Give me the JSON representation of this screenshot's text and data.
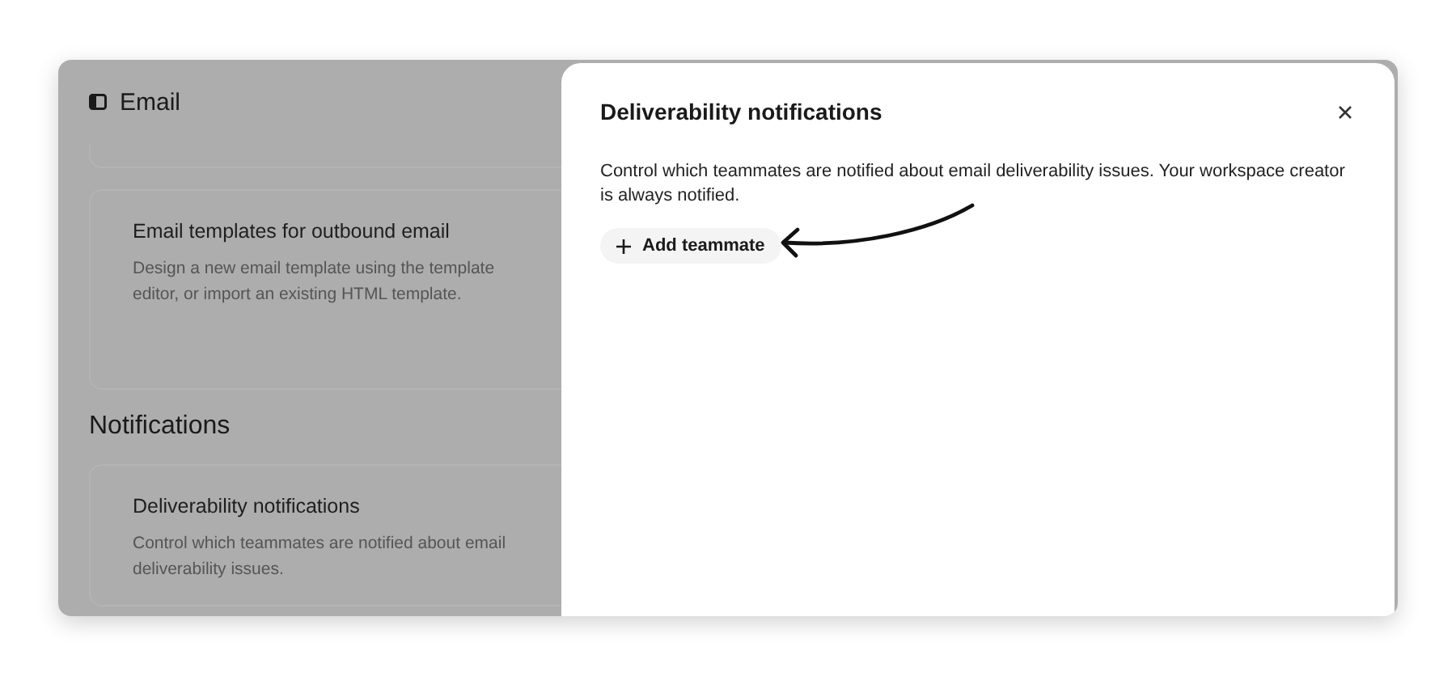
{
  "page": {
    "title": "Email",
    "email_cards": [
      {
        "title": "Email templates for outbound email",
        "description": "Design a new email template using the template editor, or import an existing HTML template."
      }
    ],
    "notifications": {
      "heading": "Notifications",
      "cards": [
        {
          "title": "Deliverability notifications",
          "description": "Control which teammates are notified about email deliverability issues."
        }
      ]
    }
  },
  "panel": {
    "title": "Deliverability notifications",
    "description": "Control which teammates are notified about email deliverability issues. Your workspace creator is always notified.",
    "add_button": "Add teammate"
  }
}
